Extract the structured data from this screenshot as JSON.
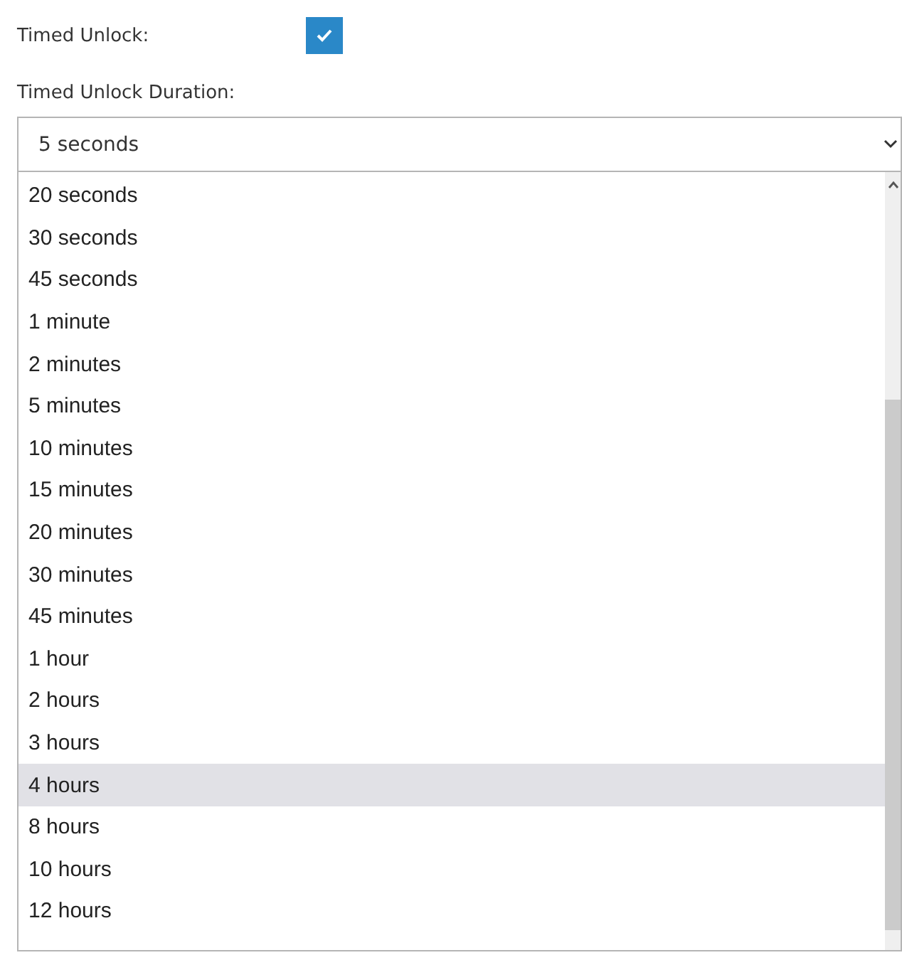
{
  "timed_unlock": {
    "label": "Timed Unlock:",
    "checked": true
  },
  "duration": {
    "label": "Timed Unlock Duration:",
    "value": "5 seconds",
    "options": [
      {
        "label": "20 seconds",
        "selected": false
      },
      {
        "label": "30 seconds",
        "selected": false
      },
      {
        "label": "45 seconds",
        "selected": false
      },
      {
        "label": "1 minute",
        "selected": false
      },
      {
        "label": "2 minutes",
        "selected": false
      },
      {
        "label": "5 minutes",
        "selected": false
      },
      {
        "label": "10 minutes",
        "selected": false
      },
      {
        "label": "15 minutes",
        "selected": false
      },
      {
        "label": "20 minutes",
        "selected": false
      },
      {
        "label": "30 minutes",
        "selected": false
      },
      {
        "label": "45 minutes",
        "selected": false
      },
      {
        "label": "1 hour",
        "selected": false
      },
      {
        "label": "2 hours",
        "selected": false
      },
      {
        "label": "3 hours",
        "selected": false
      },
      {
        "label": "4 hours",
        "selected": true
      },
      {
        "label": "8 hours",
        "selected": false
      },
      {
        "label": "10 hours",
        "selected": false
      },
      {
        "label": "12 hours",
        "selected": false
      }
    ]
  }
}
